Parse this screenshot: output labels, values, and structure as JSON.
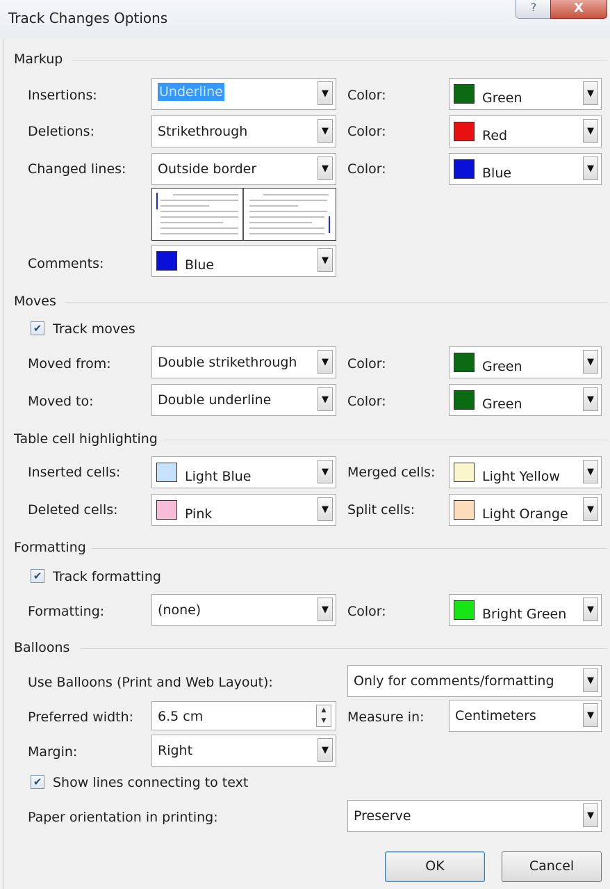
{
  "window": {
    "title": "Track Changes Options",
    "help": "?",
    "close": "X"
  },
  "markup": {
    "section": "Markup",
    "insertions": {
      "label": "Insertions:",
      "value": "Underline",
      "color_label": "Color:",
      "color": "Green",
      "swatch": "#0b6b12"
    },
    "deletions": {
      "label": "Deletions:",
      "value": "Strikethrough",
      "color_label": "Color:",
      "color": "Red",
      "swatch": "#e81010"
    },
    "changed_lines": {
      "label": "Changed lines:",
      "value": "Outside border",
      "color_label": "Color:",
      "color": "Blue",
      "swatch": "#0a10d8"
    },
    "comments": {
      "label": "Comments:",
      "color": "Blue",
      "swatch": "#0a10d8"
    }
  },
  "moves": {
    "section": "Moves",
    "track_moves": {
      "label": "Track moves",
      "checked": true
    },
    "moved_from": {
      "label": "Moved from:",
      "value": "Double strikethrough",
      "color_label": "Color:",
      "color": "Green",
      "swatch": "#0b6b12"
    },
    "moved_to": {
      "label": "Moved to:",
      "value": "Double underline",
      "color_label": "Color:",
      "color": "Green",
      "swatch": "#0b6b12"
    }
  },
  "table_cells": {
    "section": "Table cell highlighting",
    "inserted": {
      "label": "Inserted cells:",
      "color": "Light Blue",
      "swatch": "#c6e2fb"
    },
    "merged": {
      "label": "Merged cells:",
      "color": "Light Yellow",
      "swatch": "#fbf6cc"
    },
    "deleted": {
      "label": "Deleted cells:",
      "color": "Pink",
      "swatch": "#f6bcd8"
    },
    "split": {
      "label": "Split cells:",
      "color": "Light Orange",
      "swatch": "#fddcbc"
    }
  },
  "formatting": {
    "section": "Formatting",
    "track_formatting": {
      "label": "Track formatting",
      "checked": true
    },
    "formatting": {
      "label": "Formatting:",
      "value": "(none)",
      "color_label": "Color:",
      "color": "Bright Green",
      "swatch": "#16e616"
    }
  },
  "balloons": {
    "section": "Balloons",
    "use_balloons": {
      "label": "Use Balloons (Print and Web Layout):",
      "value": "Only for comments/formatting"
    },
    "preferred_width": {
      "label": "Preferred width:",
      "value": "6.5 cm"
    },
    "measure_in": {
      "label": "Measure in:",
      "value": "Centimeters"
    },
    "margin": {
      "label": "Margin:",
      "value": "Right"
    },
    "show_lines": {
      "label": "Show lines connecting to text",
      "checked": true
    },
    "paper_orientation": {
      "label": "Paper orientation in printing:",
      "value": "Preserve"
    }
  },
  "buttons": {
    "ok": "OK",
    "cancel": "Cancel"
  }
}
